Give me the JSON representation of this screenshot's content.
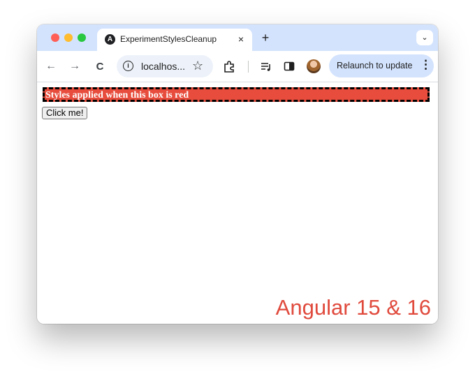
{
  "tab": {
    "title": "ExperimentStylesCleanup",
    "favicon": "angular-icon",
    "close_glyph": "×"
  },
  "new_tab_glyph": "+",
  "tab_menu_glyph": "⌄",
  "toolbar": {
    "back_glyph": "←",
    "forward_glyph": "→",
    "reload_glyph": "C",
    "url_text": "localhos...",
    "info_glyph": "i",
    "star_glyph": "☆",
    "relaunch_label": "Relaunch to update",
    "relaunch_kebab": "⋮"
  },
  "page": {
    "red_box_text": "Styles applied when this box is red",
    "button_label": "Click me!",
    "overlay_caption": "Angular 15 & 16"
  },
  "colors": {
    "tab_strip": "#d3e3fd",
    "box_fill": "#e74c3c",
    "box_border": "#000000",
    "caption": "#e04a3d"
  }
}
